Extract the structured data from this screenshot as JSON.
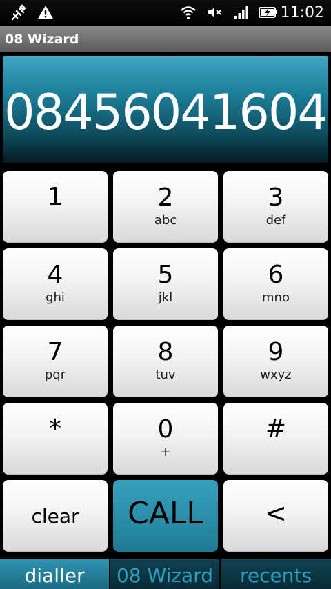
{
  "status_bar": {
    "time": "11:02",
    "icons": [
      "usb-debug-icon",
      "warning-icon",
      "wifi-icon",
      "mute-icon",
      "signal-icon",
      "battery-charging-icon"
    ]
  },
  "title_bar": {
    "title": "08 Wizard"
  },
  "display": {
    "number": "08456041604"
  },
  "keypad": {
    "keys": [
      {
        "digit": "1",
        "letters": ""
      },
      {
        "digit": "2",
        "letters": "abc"
      },
      {
        "digit": "3",
        "letters": "def"
      },
      {
        "digit": "4",
        "letters": "ghi"
      },
      {
        "digit": "5",
        "letters": "jkl"
      },
      {
        "digit": "6",
        "letters": "mno"
      },
      {
        "digit": "7",
        "letters": "pqr"
      },
      {
        "digit": "8",
        "letters": "tuv"
      },
      {
        "digit": "9",
        "letters": "wxyz"
      },
      {
        "digit": "*",
        "letters": ""
      },
      {
        "digit": "0",
        "letters": "+"
      },
      {
        "digit": "#",
        "letters": ""
      }
    ],
    "clear_label": "clear",
    "call_label": "CALL",
    "back_label": "<"
  },
  "tabs": [
    {
      "label": "dialler",
      "active": true
    },
    {
      "label": "08 Wizard",
      "active": false
    },
    {
      "label": "recents",
      "active": false
    }
  ],
  "colors": {
    "accent": "#2b8fab",
    "tab_inactive_text": "#2f9fc0"
  }
}
